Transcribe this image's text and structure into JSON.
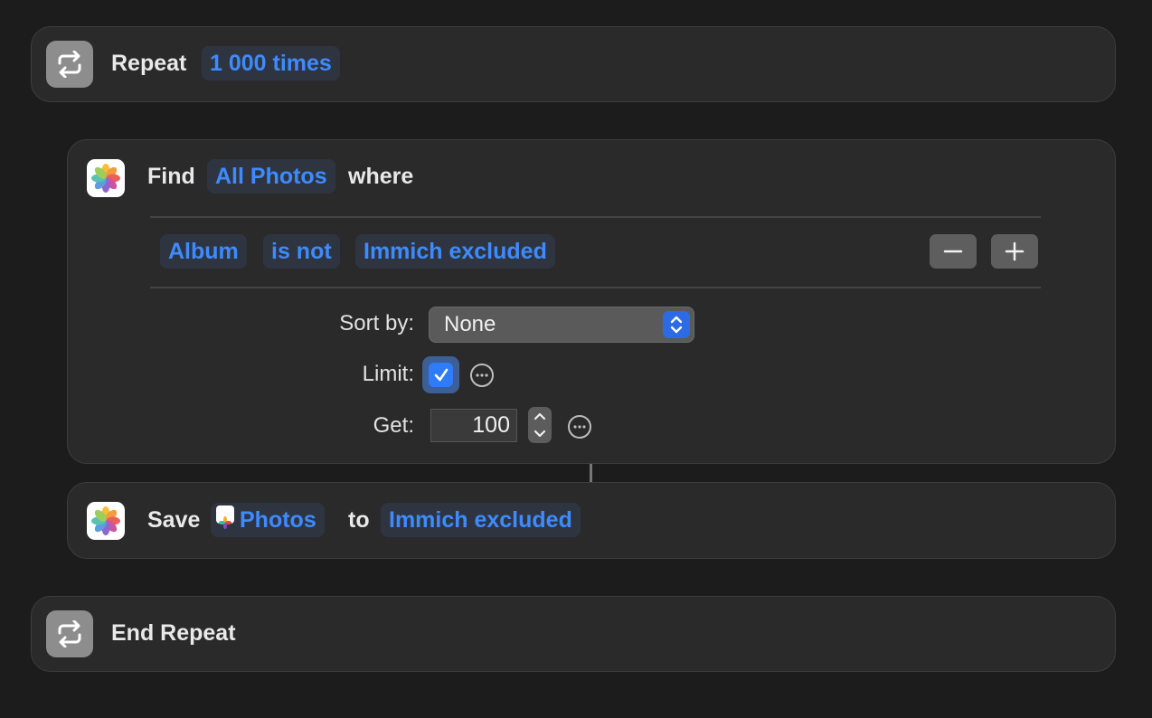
{
  "repeat_block": {
    "label": "Repeat",
    "count_token": "1 000 times",
    "icon": "repeat-icon"
  },
  "find_block": {
    "label": "Find",
    "source_token": "All Photos",
    "where_label": "where",
    "icon": "photos-app-icon",
    "filter": {
      "field": "Album",
      "operator": "is not",
      "value": "Immich excluded"
    },
    "sort_label": "Sort by:",
    "sort_value": "None",
    "limit_label": "Limit:",
    "limit_checked": true,
    "get_label": "Get:",
    "get_value": "100"
  },
  "save_block": {
    "label": "Save",
    "photos_token": "Photos",
    "to_label": "to",
    "album_token": "Immich excluded",
    "icon": "photos-app-icon"
  },
  "end_block": {
    "label": "End Repeat",
    "icon": "repeat-icon"
  },
  "colors": {
    "background": "#1c1c1c",
    "card": "#2a2a2a",
    "token_text": "#3d8bff",
    "token_bg": "#2f3540",
    "accent": "#2f7cf6"
  }
}
